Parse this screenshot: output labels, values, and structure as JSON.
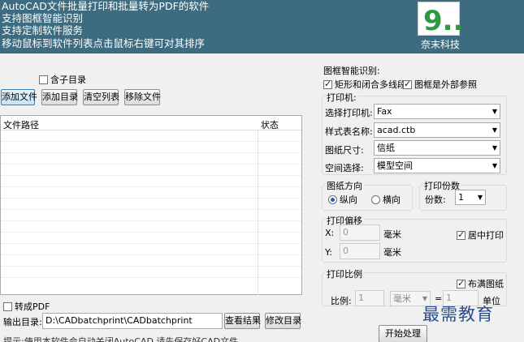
{
  "banner": {
    "lines": [
      "AutoCAD文件批量打印和批量转为PDF的软件",
      "支持图框智能识别",
      "支持定制软件服务",
      "移动鼠标到软件列表点击鼠标右键可对其排序"
    ],
    "logo_text": "9...",
    "company": "奈末科技",
    "colors": {
      "banner_bg": "#3d6b80",
      "logo_green": "#2e9a3f"
    }
  },
  "left": {
    "include_subdirs_label": "含子目录",
    "include_subdirs_checked": false,
    "buttons": {
      "add_file": "添加文件",
      "add_dir": "添加目录",
      "clear_list": "清空列表",
      "remove_file": "移除文件"
    },
    "columns": {
      "path": "文件路径",
      "status": "状态"
    },
    "to_pdf_label": "转成PDF",
    "to_pdf_checked": false,
    "output_dir_label": "输出目录:",
    "output_dir_value": "D:\\CADbatchprint\\CADbatchprint",
    "view_result": "查看结果",
    "change_dir": "修改目录",
    "hint": "提示:使用本软件会自动关闭AutoCAD,请先保存好CAD文件"
  },
  "right": {
    "smart_title": "图框智能识别:",
    "rect_polyline_label": "矩形和闭合多线段",
    "rect_polyline_checked": true,
    "xref_label": "图框是外部参照",
    "xref_checked": true,
    "printer": {
      "title": "打印机:",
      "printer_label": "选择打印机:",
      "printer_value": "Fax",
      "style_label": "样式表名称:",
      "style_value": "acad.ctb",
      "paper_label": "图纸尺寸:",
      "paper_value": "信纸",
      "space_label": "空间选择:",
      "space_value": "模型空间"
    },
    "orientation": {
      "title": "图纸方向",
      "portrait": "纵向",
      "landscape": "横向",
      "selected": "portrait"
    },
    "copies": {
      "title": "打印份数",
      "label": "份数:",
      "value": "1"
    },
    "offset": {
      "title": "打印偏移",
      "x_label": "X:",
      "x_value": "0",
      "y_label": "Y:",
      "y_value": "0",
      "unit": "毫米",
      "center_label": "居中打印",
      "center_checked": true
    },
    "scale": {
      "title": "打印比例",
      "fit_label": "布满图纸",
      "fit_checked": true,
      "ratio_label": "比例:",
      "ratio_value": "1",
      "unit_value": "毫米",
      "eq": "=",
      "right_value": "1",
      "unit_label": "单位"
    },
    "start_button": "开始处理"
  },
  "watermark": "最需教育"
}
